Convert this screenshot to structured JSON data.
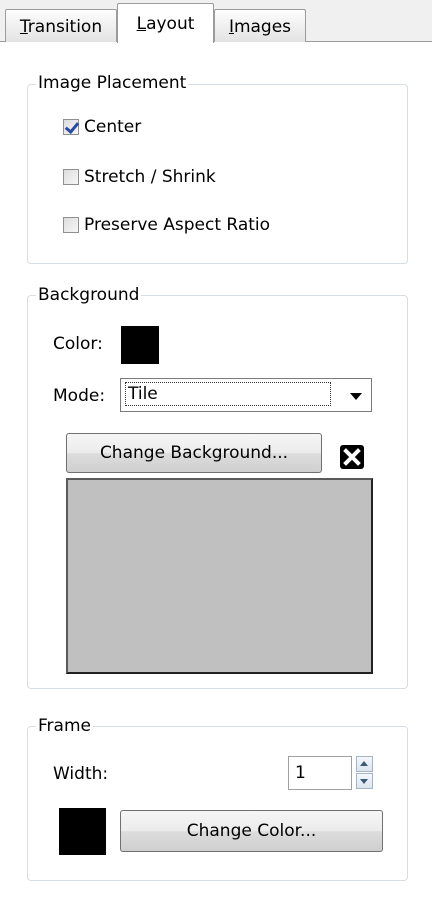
{
  "tabs": [
    {
      "label": "Transition",
      "mnemonic": "T",
      "rest": "ransition"
    },
    {
      "label": "Layout",
      "mnemonic": "L",
      "rest": "ayout"
    },
    {
      "label": "Images",
      "mnemonic": "I",
      "rest": "mages"
    }
  ],
  "active_tab": "Layout",
  "image_placement": {
    "title": "Image Placement",
    "options": [
      {
        "label": "Center",
        "checked": true
      },
      {
        "label": "Stretch / Shrink",
        "checked": false
      },
      {
        "label": "Preserve Aspect Ratio",
        "checked": false
      }
    ]
  },
  "background": {
    "title": "Background",
    "color_label": "Color:",
    "color": "#000000",
    "mode_label": "Mode:",
    "mode_value": "Tile",
    "change_button": "Change Background...",
    "preview_color": "#c0c0c0"
  },
  "frame": {
    "title": "Frame",
    "width_label": "Width:",
    "width_value": "1",
    "color": "#000000",
    "change_color_button": "Change Color..."
  }
}
